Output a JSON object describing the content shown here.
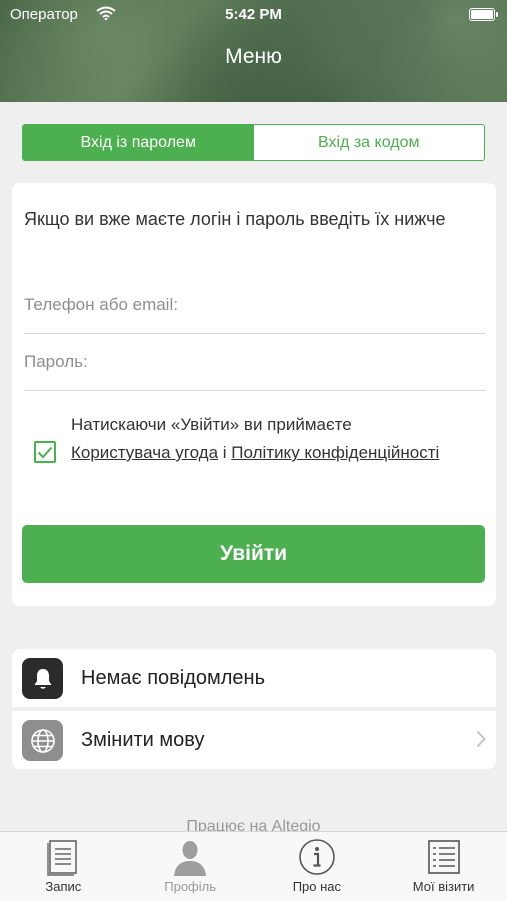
{
  "status_bar": {
    "carrier": "Оператор",
    "time": "5:42 PM"
  },
  "header": {
    "title": "Меню"
  },
  "tabs": {
    "password": "Вхід із паролем",
    "code": "Вхід за кодом"
  },
  "login": {
    "intro": "Якщо ви вже маєте логін і пароль введіть їх нижче",
    "phone_placeholder": "Телефон або email:",
    "password_placeholder": "Пароль:",
    "consent_prefix": "Натискаючи «Увійти» ви приймаєте",
    "terms_link": "Користувача угода",
    "consent_and": "і",
    "privacy_link": "Політику конфіденційності",
    "checked": true,
    "button": "Увійти"
  },
  "list": [
    {
      "label": "Немає повідомлень",
      "icon": "bell-icon",
      "bg": "#2b2b2b"
    },
    {
      "label": "Змінити мову",
      "icon": "globe-icon",
      "bg": "#8e8e8e"
    }
  ],
  "powered_by": "Працює на Altegio",
  "tabbar": [
    {
      "label": "Запис",
      "icon": "document-icon"
    },
    {
      "label": "Профіль",
      "icon": "person-icon"
    },
    {
      "label": "Про нас",
      "icon": "info-icon"
    },
    {
      "label": "Мої візити",
      "icon": "list-icon"
    }
  ],
  "colors": {
    "accent": "#4caf50"
  }
}
